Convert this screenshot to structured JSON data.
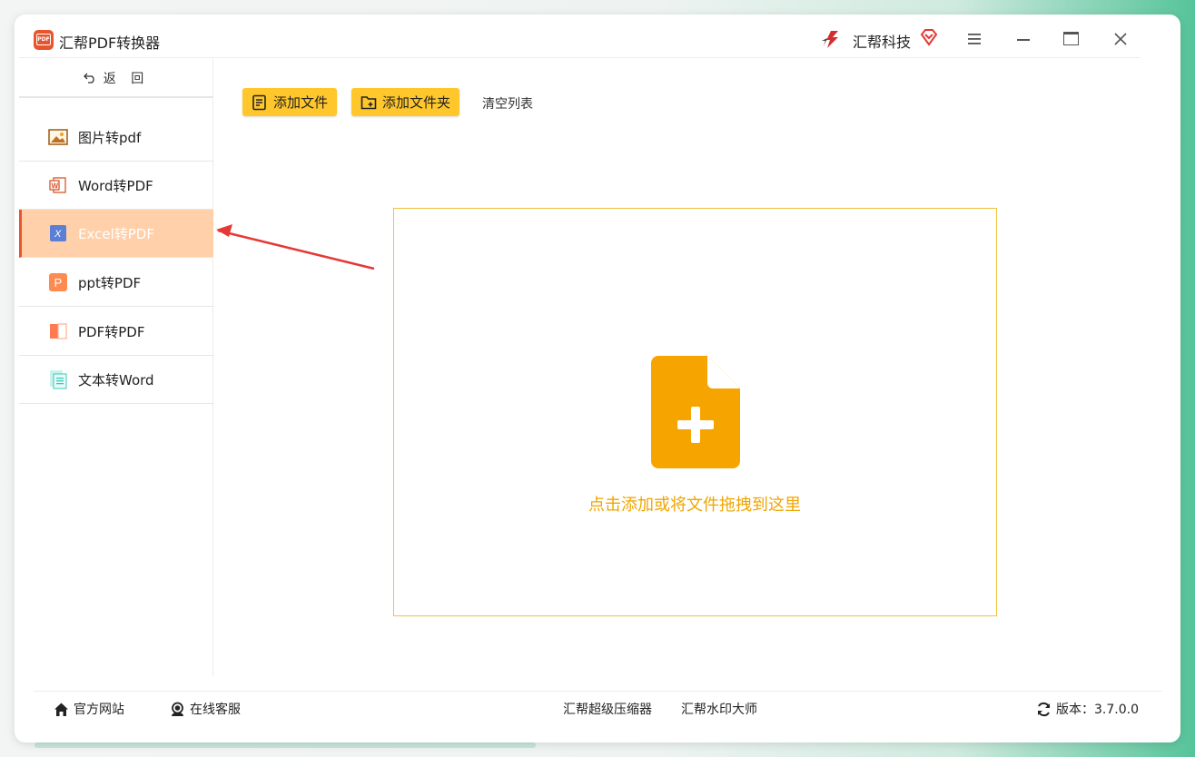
{
  "app": {
    "title": "汇帮PDF转换器",
    "logo_text": "PDF",
    "brand_name": "汇帮科技"
  },
  "sidebar": {
    "back_label": "返 回",
    "items": [
      {
        "label": "图片转pdf",
        "icon": "image-icon"
      },
      {
        "label": "Word转PDF",
        "icon": "word-icon"
      },
      {
        "label": "Excel转PDF",
        "icon": "excel-icon",
        "active": true
      },
      {
        "label": "ppt转PDF",
        "icon": "ppt-icon"
      },
      {
        "label": "PDF转PDF",
        "icon": "pdf-icon"
      },
      {
        "label": "文本转Word",
        "icon": "text-doc-icon"
      }
    ]
  },
  "toolbar": {
    "add_file_label": "添加文件",
    "add_folder_label": "添加文件夹",
    "clear_list_label": "清空列表"
  },
  "dropzone": {
    "hint_text": "点击添加或将文件拖拽到这里"
  },
  "footer": {
    "official_site_label": "官方网站",
    "online_service_label": "在线客服",
    "compressor_link": "汇帮超级压缩器",
    "watermark_link": "汇帮水印大师",
    "version_text": "版本：3.7.0.0"
  },
  "colors": {
    "accent": "#ffc72c",
    "active_item_bg": "#ffd0aa",
    "drop_icon": "#f6a500",
    "pointer_arrow": "#e53935"
  }
}
